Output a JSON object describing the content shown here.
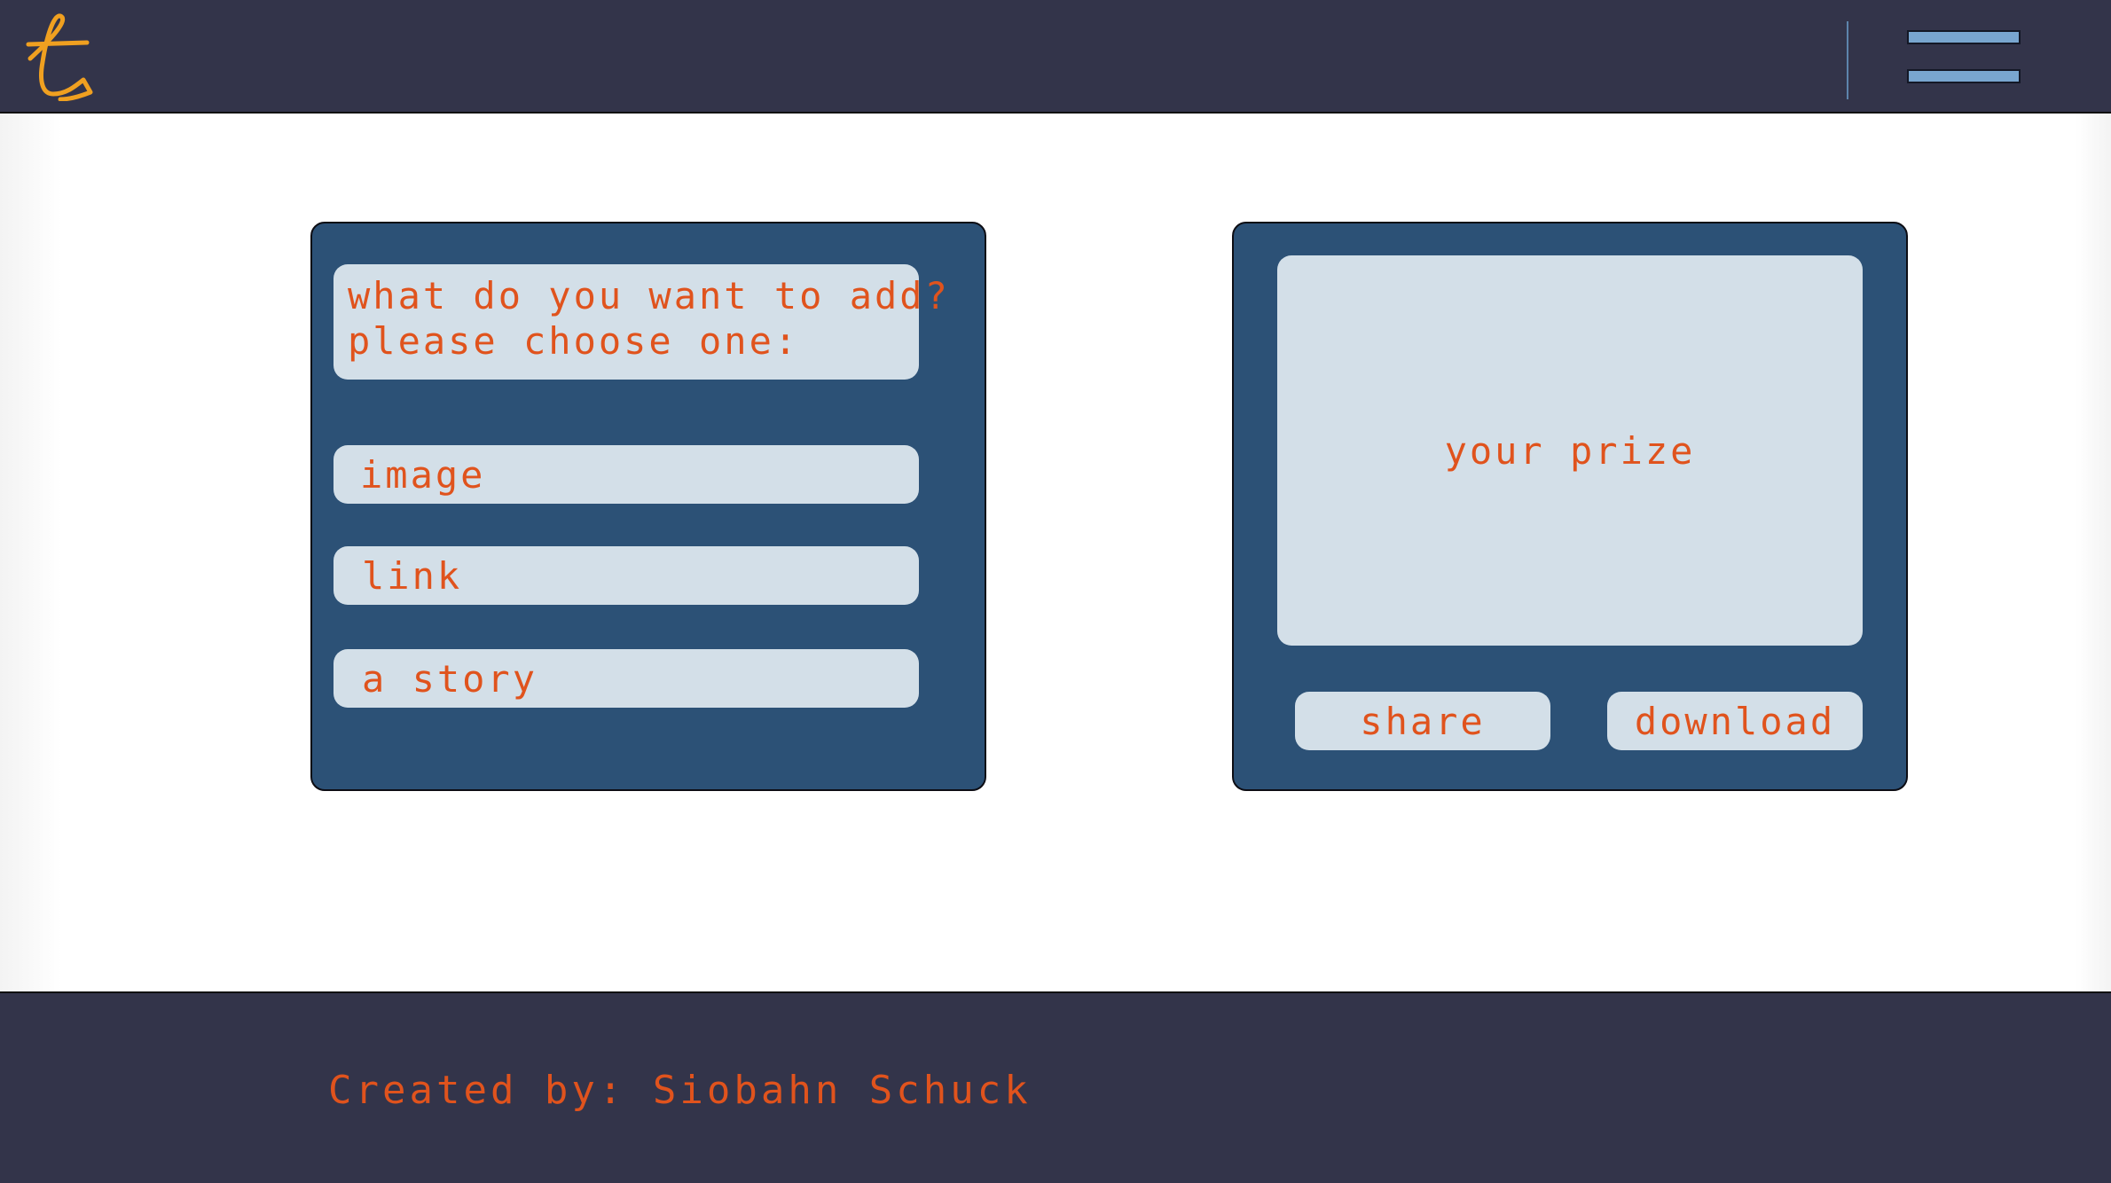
{
  "header": {
    "logo_letter": "t",
    "menu_icon": "hamburger-menu-icon"
  },
  "choose_panel": {
    "question_line1": "what do you want to add?",
    "question_line2": "please choose one:",
    "options": [
      {
        "label": "image"
      },
      {
        "label": "link"
      },
      {
        "label": "a story"
      }
    ]
  },
  "prize_panel": {
    "prize_label": "your prize",
    "share_label": "share",
    "download_label": "download"
  },
  "footer": {
    "credit": "Created by: Siobahn Schuck"
  },
  "colors": {
    "header_bg": "#33344a",
    "panel_bg": "#2c5176",
    "chip_bg": "#d3dfe8",
    "text_accent": "#e0531d",
    "logo": "#f0a020",
    "menu_bar": "#79a6cf"
  }
}
